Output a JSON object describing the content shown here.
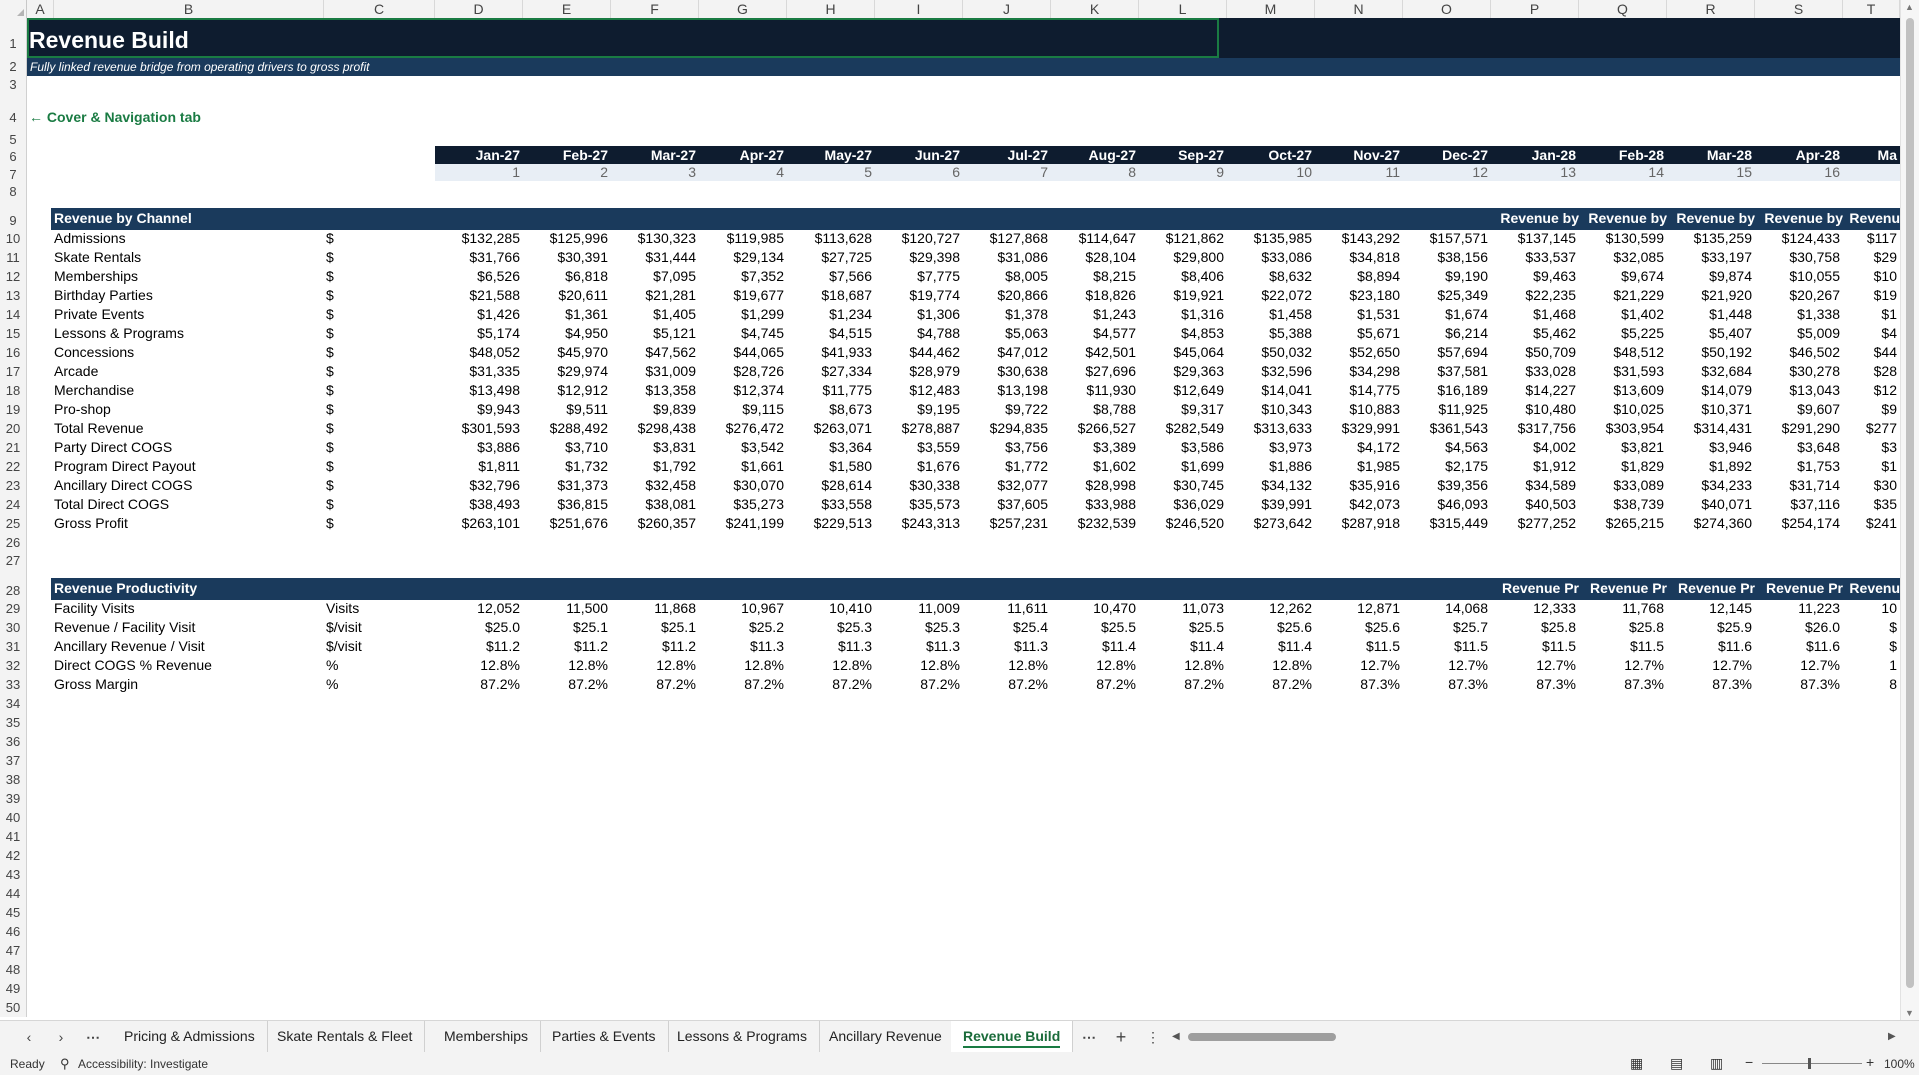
{
  "columns": [
    "A",
    "B",
    "C",
    "D",
    "E",
    "F",
    "G",
    "H",
    "I",
    "J",
    "K",
    "L",
    "M",
    "N",
    "O",
    "P",
    "Q",
    "R",
    "S",
    "T"
  ],
  "title": "Revenue Build",
  "subtitle": "Fully linked revenue bridge from operating drivers to gross profit",
  "nav_link": "← Cover & Navigation tab",
  "months": [
    "Jan-27",
    "Feb-27",
    "Mar-27",
    "Apr-27",
    "May-27",
    "Jun-27",
    "Jul-27",
    "Aug-27",
    "Sep-27",
    "Oct-27",
    "Nov-27",
    "Dec-27",
    "Jan-28",
    "Feb-28",
    "Mar-28",
    "Apr-28",
    "Ma"
  ],
  "period_numbers": [
    "1",
    "2",
    "3",
    "4",
    "5",
    "6",
    "7",
    "8",
    "9",
    "10",
    "11",
    "12",
    "13",
    "14",
    "15",
    "16",
    ""
  ],
  "section1": {
    "header": "Revenue by Channel",
    "header_repeats": [
      "Revenue by",
      "Revenue by",
      "Revenue by",
      "Revenue by",
      "Revenu"
    ],
    "rows": [
      {
        "label": "Admissions",
        "unit": "$",
        "values": [
          "$132,285",
          "$125,996",
          "$130,323",
          "$119,985",
          "$113,628",
          "$120,727",
          "$127,868",
          "$114,647",
          "$121,862",
          "$135,985",
          "$143,292",
          "$157,571",
          "$137,145",
          "$130,599",
          "$135,259",
          "$124,433",
          "$117"
        ]
      },
      {
        "label": "Skate Rentals",
        "unit": "$",
        "values": [
          "$31,766",
          "$30,391",
          "$31,444",
          "$29,134",
          "$27,725",
          "$29,398",
          "$31,086",
          "$28,104",
          "$29,800",
          "$33,086",
          "$34,818",
          "$38,156",
          "$33,537",
          "$32,085",
          "$33,197",
          "$30,758",
          "$29"
        ]
      },
      {
        "label": "Memberships",
        "unit": "$",
        "values": [
          "$6,526",
          "$6,818",
          "$7,095",
          "$7,352",
          "$7,566",
          "$7,775",
          "$8,005",
          "$8,215",
          "$8,406",
          "$8,632",
          "$8,894",
          "$9,190",
          "$9,463",
          "$9,674",
          "$9,874",
          "$10,055",
          "$10"
        ]
      },
      {
        "label": "Birthday Parties",
        "unit": "$",
        "values": [
          "$21,588",
          "$20,611",
          "$21,281",
          "$19,677",
          "$18,687",
          "$19,774",
          "$20,866",
          "$18,826",
          "$19,921",
          "$22,072",
          "$23,180",
          "$25,349",
          "$22,235",
          "$21,229",
          "$21,920",
          "$20,267",
          "$19"
        ]
      },
      {
        "label": "Private Events",
        "unit": "$",
        "values": [
          "$1,426",
          "$1,361",
          "$1,405",
          "$1,299",
          "$1,234",
          "$1,306",
          "$1,378",
          "$1,243",
          "$1,316",
          "$1,458",
          "$1,531",
          "$1,674",
          "$1,468",
          "$1,402",
          "$1,448",
          "$1,338",
          "$1"
        ]
      },
      {
        "label": "Lessons & Programs",
        "unit": "$",
        "values": [
          "$5,174",
          "$4,950",
          "$5,121",
          "$4,745",
          "$4,515",
          "$4,788",
          "$5,063",
          "$4,577",
          "$4,853",
          "$5,388",
          "$5,671",
          "$6,214",
          "$5,462",
          "$5,225",
          "$5,407",
          "$5,009",
          "$4"
        ]
      },
      {
        "label": "Concessions",
        "unit": "$",
        "values": [
          "$48,052",
          "$45,970",
          "$47,562",
          "$44,065",
          "$41,933",
          "$44,462",
          "$47,012",
          "$42,501",
          "$45,064",
          "$50,032",
          "$52,650",
          "$57,694",
          "$50,709",
          "$48,512",
          "$50,192",
          "$46,502",
          "$44"
        ]
      },
      {
        "label": "Arcade",
        "unit": "$",
        "values": [
          "$31,335",
          "$29,974",
          "$31,009",
          "$28,726",
          "$27,334",
          "$28,979",
          "$30,638",
          "$27,696",
          "$29,363",
          "$32,596",
          "$34,298",
          "$37,581",
          "$33,028",
          "$31,593",
          "$32,684",
          "$30,278",
          "$28"
        ]
      },
      {
        "label": "Merchandise",
        "unit": "$",
        "values": [
          "$13,498",
          "$12,912",
          "$13,358",
          "$12,374",
          "$11,775",
          "$12,483",
          "$13,198",
          "$11,930",
          "$12,649",
          "$14,041",
          "$14,775",
          "$16,189",
          "$14,227",
          "$13,609",
          "$14,079",
          "$13,043",
          "$12"
        ]
      },
      {
        "label": "Pro-shop",
        "unit": "$",
        "values": [
          "$9,943",
          "$9,511",
          "$9,839",
          "$9,115",
          "$8,673",
          "$9,195",
          "$9,722",
          "$8,788",
          "$9,317",
          "$10,343",
          "$10,883",
          "$11,925",
          "$10,480",
          "$10,025",
          "$10,371",
          "$9,607",
          "$9"
        ]
      },
      {
        "label": "Total Revenue",
        "unit": "$",
        "values": [
          "$301,593",
          "$288,492",
          "$298,438",
          "$276,472",
          "$263,071",
          "$278,887",
          "$294,835",
          "$266,527",
          "$282,549",
          "$313,633",
          "$329,991",
          "$361,543",
          "$317,756",
          "$303,954",
          "$314,431",
          "$291,290",
          "$277"
        ]
      },
      {
        "label": "Party Direct COGS",
        "unit": "$",
        "values": [
          "$3,886",
          "$3,710",
          "$3,831",
          "$3,542",
          "$3,364",
          "$3,559",
          "$3,756",
          "$3,389",
          "$3,586",
          "$3,973",
          "$4,172",
          "$4,563",
          "$4,002",
          "$3,821",
          "$3,946",
          "$3,648",
          "$3"
        ]
      },
      {
        "label": "Program Direct Payout",
        "unit": "$",
        "values": [
          "$1,811",
          "$1,732",
          "$1,792",
          "$1,661",
          "$1,580",
          "$1,676",
          "$1,772",
          "$1,602",
          "$1,699",
          "$1,886",
          "$1,985",
          "$2,175",
          "$1,912",
          "$1,829",
          "$1,892",
          "$1,753",
          "$1"
        ]
      },
      {
        "label": "Ancillary Direct COGS",
        "unit": "$",
        "values": [
          "$32,796",
          "$31,373",
          "$32,458",
          "$30,070",
          "$28,614",
          "$30,338",
          "$32,077",
          "$28,998",
          "$30,745",
          "$34,132",
          "$35,916",
          "$39,356",
          "$34,589",
          "$33,089",
          "$34,233",
          "$31,714",
          "$30"
        ]
      },
      {
        "label": "Total Direct COGS",
        "unit": "$",
        "values": [
          "$38,493",
          "$36,815",
          "$38,081",
          "$35,273",
          "$33,558",
          "$35,573",
          "$37,605",
          "$33,988",
          "$36,029",
          "$39,991",
          "$42,073",
          "$46,093",
          "$40,503",
          "$38,739",
          "$40,071",
          "$37,116",
          "$35"
        ]
      },
      {
        "label": "Gross Profit",
        "unit": "$",
        "values": [
          "$263,101",
          "$251,676",
          "$260,357",
          "$241,199",
          "$229,513",
          "$243,313",
          "$257,231",
          "$232,539",
          "$246,520",
          "$273,642",
          "$287,918",
          "$315,449",
          "$277,252",
          "$265,215",
          "$274,360",
          "$254,174",
          "$241"
        ]
      }
    ]
  },
  "section2": {
    "header": "Revenue Productivity",
    "header_repeats": [
      "Revenue Pr",
      "Revenue Pr",
      "Revenue Pr",
      "Revenue Pr",
      "Revenu"
    ],
    "rows": [
      {
        "label": "Facility Visits",
        "unit": "Visits",
        "values": [
          "12,052",
          "11,500",
          "11,868",
          "10,967",
          "10,410",
          "11,009",
          "11,611",
          "10,470",
          "11,073",
          "12,262",
          "12,871",
          "14,068",
          "12,333",
          "11,768",
          "12,145",
          "11,223",
          "10"
        ]
      },
      {
        "label": "Revenue / Facility Visit",
        "unit": "$/visit",
        "values": [
          "$25.0",
          "$25.1",
          "$25.1",
          "$25.2",
          "$25.3",
          "$25.3",
          "$25.4",
          "$25.5",
          "$25.5",
          "$25.6",
          "$25.6",
          "$25.7",
          "$25.8",
          "$25.8",
          "$25.9",
          "$26.0",
          "$"
        ]
      },
      {
        "label": "Ancillary Revenue / Visit",
        "unit": "$/visit",
        "values": [
          "$11.2",
          "$11.2",
          "$11.2",
          "$11.3",
          "$11.3",
          "$11.3",
          "$11.3",
          "$11.4",
          "$11.4",
          "$11.4",
          "$11.5",
          "$11.5",
          "$11.5",
          "$11.5",
          "$11.6",
          "$11.6",
          "$"
        ]
      },
      {
        "label": "Direct COGS % Revenue",
        "unit": "%",
        "values": [
          "12.8%",
          "12.8%",
          "12.8%",
          "12.8%",
          "12.8%",
          "12.8%",
          "12.8%",
          "12.8%",
          "12.8%",
          "12.8%",
          "12.7%",
          "12.7%",
          "12.7%",
          "12.7%",
          "12.7%",
          "12.7%",
          "1"
        ]
      },
      {
        "label": "Gross Margin",
        "unit": "%",
        "values": [
          "87.2%",
          "87.2%",
          "87.2%",
          "87.2%",
          "87.2%",
          "87.2%",
          "87.2%",
          "87.2%",
          "87.2%",
          "87.2%",
          "87.3%",
          "87.3%",
          "87.3%",
          "87.3%",
          "87.3%",
          "87.3%",
          "8"
        ]
      }
    ]
  },
  "sheet_tabs": [
    "Pricing & Admissions",
    "Skate Rentals & Fleet",
    "Memberships",
    "Parties & Events",
    "Lessons & Programs",
    "Ancillary Revenue",
    "Revenue Build"
  ],
  "active_tab": "Revenue Build",
  "status": {
    "ready": "Ready",
    "accessibility": "Accessibility: Investigate",
    "zoom": "100%"
  },
  "colors": {
    "title_bg": "#0e1c2f",
    "subtitle_bg": "#1a3a5c",
    "section_bg": "#1a3a5c",
    "month_bg": "#0e1c2f",
    "period_bg": "#e8eef5",
    "link": "#1a7b43",
    "header_accent": "#1a7b43"
  }
}
